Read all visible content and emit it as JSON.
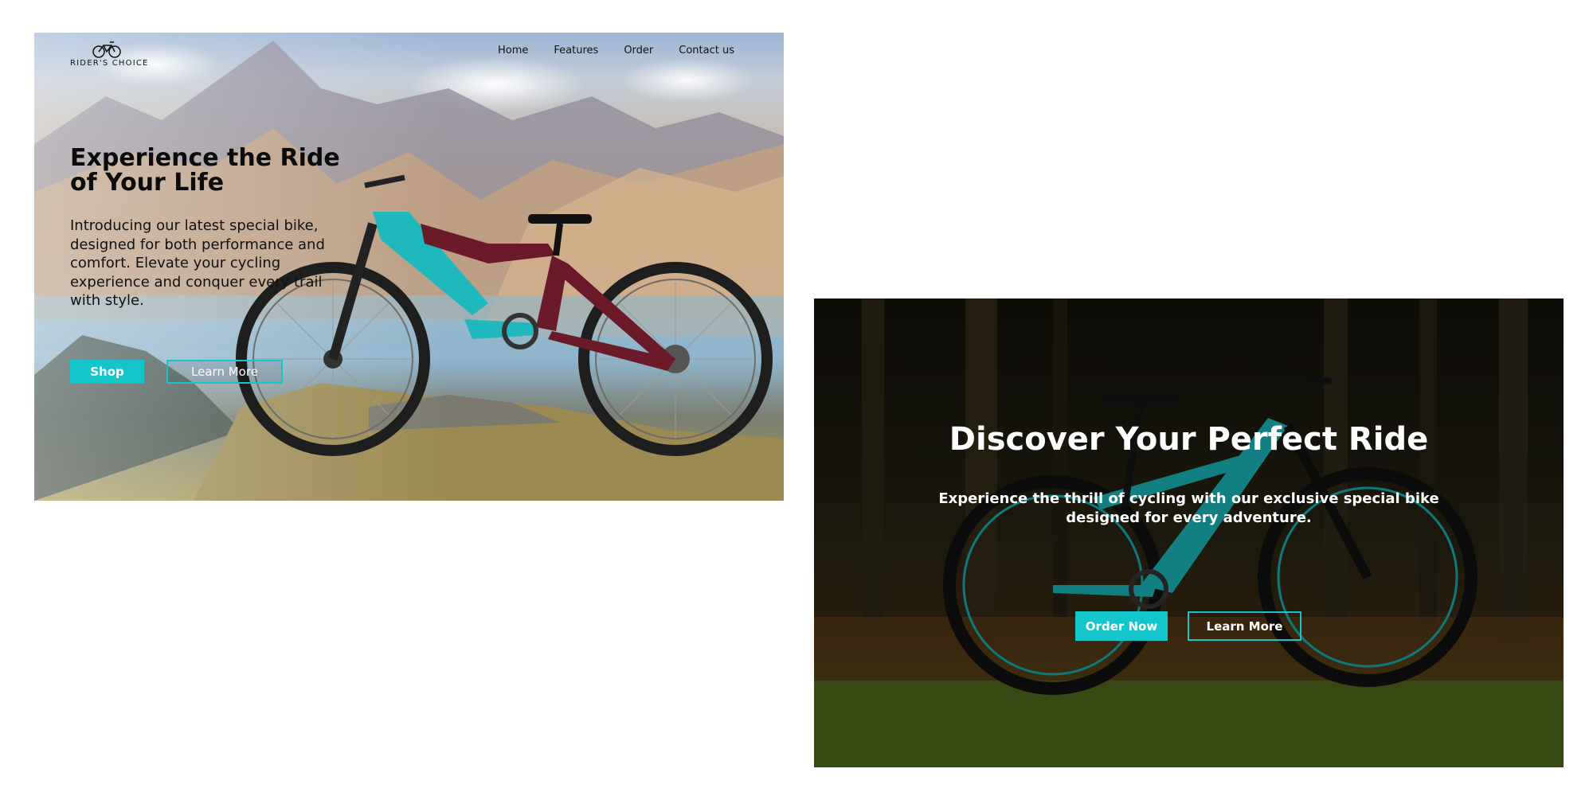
{
  "colors": {
    "accent": "#14c6cc",
    "nav_text": "#111111",
    "hero2_text": "#ffffff"
  },
  "panel1": {
    "logo": {
      "icon": "bicycle-icon",
      "text": "RIDER'S CHOICE"
    },
    "nav": {
      "home": "Home",
      "features": "Features",
      "order": "Order",
      "contact": "Contact us"
    },
    "hero": {
      "title": "Experience the Ride of Your Life",
      "text": "Introducing our latest special bike, designed for both performance and comfort. Elevate your cycling experience and conquer every trail with style.",
      "primary_button": "Shop",
      "secondary_button": "Learn More"
    }
  },
  "panel2": {
    "hero": {
      "title": "Discover Your Perfect Ride",
      "text": "Experience the thrill of cycling with our exclusive special bike designed for every adventure.",
      "primary_button": "Order Now",
      "secondary_button": "Learn More"
    }
  }
}
